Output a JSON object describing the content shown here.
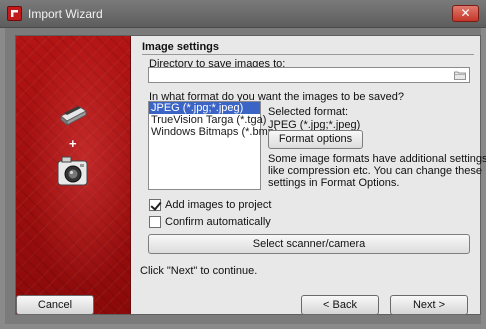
{
  "window": {
    "title": "Import Wizard",
    "close_glyph": "✕"
  },
  "sidebar": {
    "plus": "+"
  },
  "section": {
    "title": "Image settings"
  },
  "directory": {
    "label": "Directory to save images to:",
    "value": ""
  },
  "format": {
    "question": "In what format do you want the images to be saved?",
    "options": [
      "JPEG (*.jpg;*.jpeg)",
      "TrueVision Targa (*.tga)",
      "Windows Bitmaps (*.bmp)"
    ],
    "selected_index": 0,
    "selected_label": "Selected format:",
    "selected_value": "JPEG (*.jpg;*.jpeg)",
    "options_button": "Format options",
    "description": [
      "Some image formats have additional settings,",
      "like compression etc. You can change these",
      "settings in Format Options."
    ]
  },
  "checkboxes": {
    "add_to_project": {
      "label": "Add images to project",
      "checked": true
    },
    "confirm_auto": {
      "label": "Confirm automatically",
      "checked": false
    }
  },
  "scanner_button": "Select scanner/camera",
  "hint": "Click \"Next\" to continue.",
  "footer": {
    "cancel": "Cancel",
    "back": "< Back",
    "next": "Next >"
  },
  "colors": {
    "titlebar": "#6b6b6b",
    "sidebar_red": "#a81010",
    "selection": "#3b64c7"
  }
}
